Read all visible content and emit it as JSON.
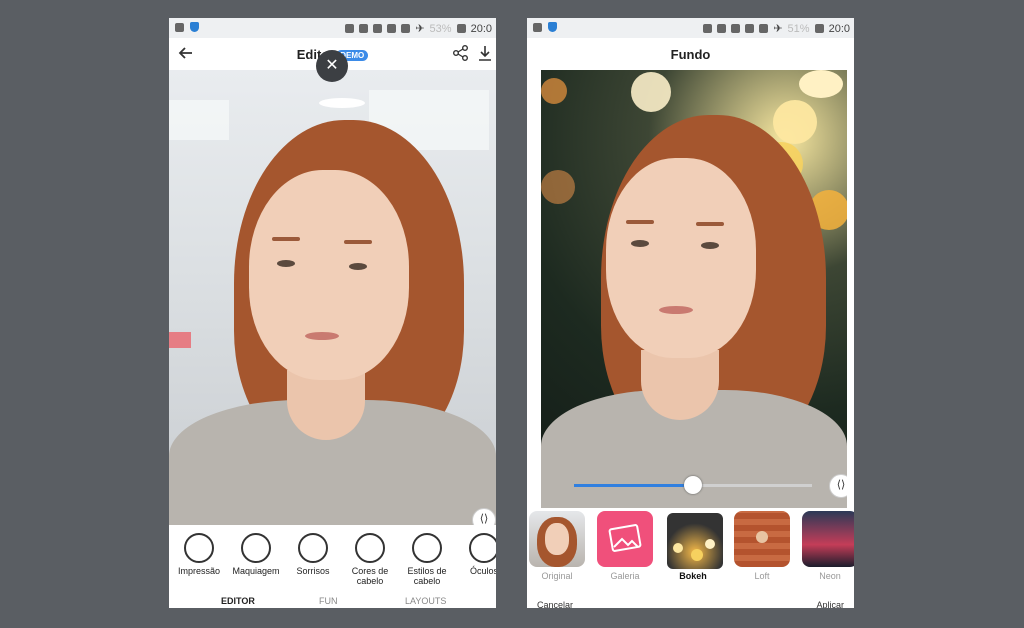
{
  "left": {
    "status": {
      "battery": "53%",
      "time": "20:0"
    },
    "title": "Editor",
    "badge": "DEMO",
    "tools": [
      {
        "label": "Impressão",
        "icon": "face-sparkle-icon"
      },
      {
        "label": "Maquiagem",
        "icon": "face-makeup-icon"
      },
      {
        "label": "Sorrisos",
        "icon": "face-smile-icon"
      },
      {
        "label": "Cores de cabelo",
        "icon": "hair-color-icon"
      },
      {
        "label": "Estilos de cabelo",
        "icon": "hair-style-icon"
      },
      {
        "label": "Óculos",
        "icon": "glasses-icon"
      }
    ],
    "tabs": [
      "EDITOR",
      "FUN",
      "LAYOUTS"
    ]
  },
  "right": {
    "status": {
      "battery": "51%",
      "time": "20:0"
    },
    "title": "Fundo",
    "slider_value": 0.5,
    "backgrounds": [
      {
        "label": "Original",
        "selected": false
      },
      {
        "label": "Galeria",
        "selected": false
      },
      {
        "label": "Bokeh",
        "selected": true
      },
      {
        "label": "Loft",
        "selected": false
      },
      {
        "label": "Neon",
        "selected": false
      }
    ],
    "bottom_left": "Cancelar",
    "bottom_right": "Aplicar"
  },
  "colors": {
    "accent": "#3b8be8",
    "galeria": "#f0507b",
    "backdrop": "#5a5e63"
  }
}
